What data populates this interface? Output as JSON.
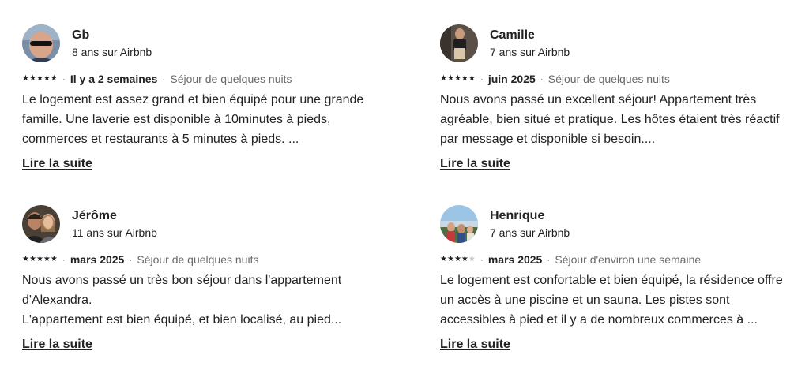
{
  "reviews": [
    {
      "name": "Gb",
      "tenure": "8 ans sur Airbnb",
      "avatar": "avatar-man-sunglasses",
      "rating": 5,
      "date": "Il y a 2 semaines",
      "stay": "Séjour de quelques nuits",
      "text": "Le logement est assez grand et bien équipé pour une grande famille. Une laverie est disponible à 10minutes à pieds, commerces et restaurants à 5 minutes à pieds. ...",
      "more": "Lire la suite"
    },
    {
      "name": "Camille",
      "tenure": "7 ans sur Airbnb",
      "avatar": "avatar-person-standing",
      "rating": 5,
      "date": "juin 2025",
      "stay": "Séjour de quelques nuits",
      "text": "Nous avons passé un excellent séjour! Appartement très agréable, bien situé et pratique. Les hôtes étaient très réactif par message et disponible si besoin....",
      "more": "Lire la suite"
    },
    {
      "name": "Jérôme",
      "tenure": "11 ans sur Airbnb",
      "avatar": "avatar-couple",
      "rating": 5,
      "date": "mars 2025",
      "stay": "Séjour de quelques nuits",
      "text_lines": [
        "Nous avons passé un très bon séjour dans l'appartement d'Alexandra.",
        "L'appartement est bien équipé, et bien localisé, au pied..."
      ],
      "more": "Lire la suite"
    },
    {
      "name": "Henrique",
      "tenure": "7 ans sur Airbnb",
      "avatar": "avatar-group-outdoor",
      "rating": 4,
      "date": "mars 2025",
      "stay": "Séjour d'environ une semaine",
      "text": "Le logement est confortable et bien équipé, la résidence offre un accès à une piscine et un sauna. Les pistes sont accessibles à pied et il y a de nombreux commerces à ...",
      "more": "Lire la suite"
    }
  ],
  "colors": {
    "text": "#222222",
    "muted": "#6a6a6a",
    "star_off": "#c8c8c8"
  }
}
